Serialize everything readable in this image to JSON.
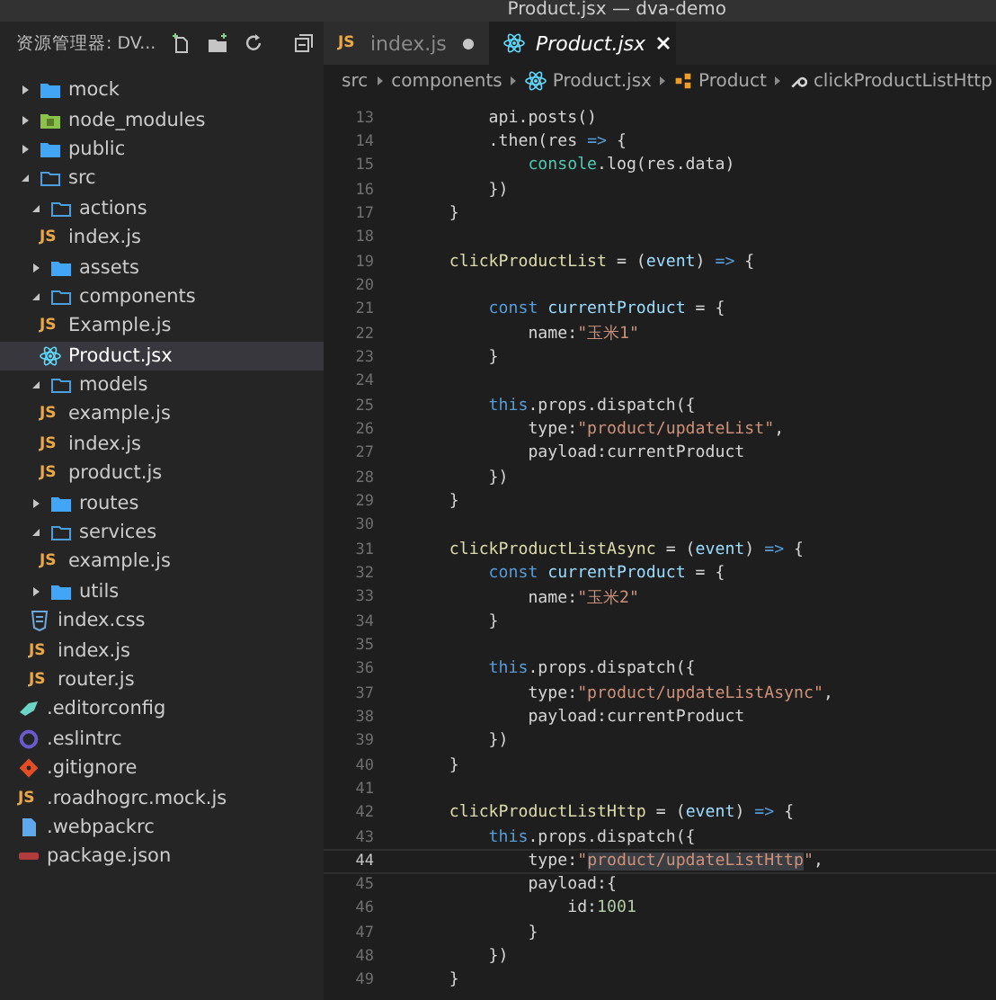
{
  "window": {
    "title": "Product.jsx — dva-demo"
  },
  "explorer": {
    "title": "资源管理器: DV...",
    "tree": [
      {
        "name": "mock",
        "kind": "folder",
        "expanded": false,
        "selected": false
      },
      {
        "name": "node_modules",
        "kind": "modules-folder",
        "expanded": false,
        "selected": false
      },
      {
        "name": "public",
        "kind": "folder",
        "expanded": false,
        "selected": false
      },
      {
        "name": "src",
        "kind": "folder",
        "expanded": true,
        "selected": false,
        "children": [
          {
            "name": "actions",
            "kind": "folder",
            "expanded": true,
            "selected": false,
            "children": [
              {
                "name": "index.js",
                "kind": "js",
                "badge": "JS",
                "selected": false
              }
            ]
          },
          {
            "name": "assets",
            "kind": "folder",
            "expanded": false,
            "selected": false
          },
          {
            "name": "components",
            "kind": "folder",
            "expanded": true,
            "selected": false,
            "children": [
              {
                "name": "Example.js",
                "kind": "js",
                "badge": "JS",
                "selected": false
              },
              {
                "name": "Product.jsx",
                "kind": "react",
                "selected": true
              }
            ]
          },
          {
            "name": "models",
            "kind": "folder",
            "expanded": true,
            "selected": false,
            "children": [
              {
                "name": "example.js",
                "kind": "js",
                "badge": "JS",
                "selected": false
              },
              {
                "name": "index.js",
                "kind": "js",
                "badge": "JS",
                "selected": false
              },
              {
                "name": "product.js",
                "kind": "js",
                "badge": "JS",
                "selected": false
              }
            ]
          },
          {
            "name": "routes",
            "kind": "folder",
            "expanded": false,
            "selected": false
          },
          {
            "name": "services",
            "kind": "folder",
            "expanded": true,
            "selected": false,
            "children": [
              {
                "name": "example.js",
                "kind": "js",
                "badge": "JS",
                "selected": false
              }
            ]
          },
          {
            "name": "utils",
            "kind": "folder",
            "expanded": false,
            "selected": false
          },
          {
            "name": "index.css",
            "kind": "css",
            "selected": false
          },
          {
            "name": "index.js",
            "kind": "js",
            "badge": "JS",
            "selected": false
          },
          {
            "name": "router.js",
            "kind": "js",
            "badge": "JS",
            "selected": false
          }
        ]
      },
      {
        "name": ".editorconfig",
        "kind": "config",
        "selected": false
      },
      {
        "name": ".eslintrc",
        "kind": "eslint",
        "selected": false
      },
      {
        "name": ".gitignore",
        "kind": "git",
        "selected": false
      },
      {
        "name": ".roadhogrc.mock.js",
        "kind": "js",
        "badge": "JS",
        "selected": false
      },
      {
        "name": ".webpackrc",
        "kind": "file",
        "selected": false
      },
      {
        "name": "package.json",
        "kind": "json",
        "selected": false
      }
    ]
  },
  "tabs": [
    {
      "label": "index.js",
      "kind": "js",
      "badge": "JS",
      "selected": false,
      "modified": true
    },
    {
      "label": "Product.jsx",
      "kind": "react",
      "selected": true,
      "modified": false
    }
  ],
  "breadcrumb": [
    {
      "label": "src",
      "kind": "folder"
    },
    {
      "label": "components",
      "kind": "folder"
    },
    {
      "label": "Product.jsx",
      "kind": "react"
    },
    {
      "label": "Product",
      "kind": "class"
    },
    {
      "label": "clickProductListHttp",
      "kind": "method"
    }
  ],
  "code": [
    {
      "number": "13",
      "current": false,
      "tokens": [
        {
          "kind": "plain",
          "text": "        api.posts()"
        }
      ]
    },
    {
      "number": "14",
      "current": false,
      "tokens": [
        {
          "kind": "plain",
          "text": "        .then(res "
        },
        {
          "kind": "keyword",
          "text": "=>"
        },
        {
          "kind": "plain",
          "text": " {"
        }
      ]
    },
    {
      "number": "15",
      "current": false,
      "tokens": [
        {
          "kind": "type",
          "text": "            console"
        },
        {
          "kind": "plain",
          "text": ".log(res.data)"
        }
      ]
    },
    {
      "number": "16",
      "current": false,
      "tokens": [
        {
          "kind": "plain",
          "text": "        })"
        }
      ]
    },
    {
      "number": "17",
      "current": false,
      "tokens": [
        {
          "kind": "plain",
          "text": "    }"
        }
      ]
    },
    {
      "number": "18",
      "current": false
    },
    {
      "number": "19",
      "current": false,
      "tokens": [
        {
          "kind": "func",
          "text": "    clickProductList"
        },
        {
          "kind": "plain",
          "text": " = ("
        },
        {
          "kind": "variable",
          "text": "event"
        },
        {
          "kind": "plain",
          "text": ") "
        },
        {
          "kind": "keyword",
          "text": "=>"
        },
        {
          "kind": "plain",
          "text": " {"
        }
      ]
    },
    {
      "number": "20",
      "current": false
    },
    {
      "number": "21",
      "current": false,
      "tokens": [
        {
          "kind": "keyword",
          "text": "        const"
        },
        {
          "kind": "variable",
          "text": " currentProduct"
        },
        {
          "kind": "plain",
          "text": " = {"
        }
      ]
    },
    {
      "number": "22",
      "current": false,
      "tokens": [
        {
          "kind": "plain",
          "text": "            name:"
        },
        {
          "kind": "string",
          "text": "\"玉米1\""
        }
      ]
    },
    {
      "number": "23",
      "current": false,
      "tokens": [
        {
          "kind": "plain",
          "text": "        }"
        }
      ]
    },
    {
      "number": "24",
      "current": false
    },
    {
      "number": "25",
      "current": false,
      "tokens": [
        {
          "kind": "keyword",
          "text": "        this"
        },
        {
          "kind": "plain",
          "text": ".props.dispatch({"
        }
      ]
    },
    {
      "number": "26",
      "current": false,
      "tokens": [
        {
          "kind": "plain",
          "text": "            type:"
        },
        {
          "kind": "string",
          "text": "\"product/updateList\""
        },
        {
          "kind": "plain",
          "text": ","
        }
      ]
    },
    {
      "number": "27",
      "current": false,
      "tokens": [
        {
          "kind": "plain",
          "text": "            payload:currentProduct"
        }
      ]
    },
    {
      "number": "28",
      "current": false,
      "tokens": [
        {
          "kind": "plain",
          "text": "        })"
        }
      ]
    },
    {
      "number": "29",
      "current": false,
      "tokens": [
        {
          "kind": "plain",
          "text": "    }"
        }
      ]
    },
    {
      "number": "30",
      "current": false
    },
    {
      "number": "31",
      "current": false,
      "tokens": [
        {
          "kind": "func",
          "text": "    clickProductListAsync"
        },
        {
          "kind": "plain",
          "text": " = ("
        },
        {
          "kind": "variable",
          "text": "event"
        },
        {
          "kind": "plain",
          "text": ") "
        },
        {
          "kind": "keyword",
          "text": "=>"
        },
        {
          "kind": "plain",
          "text": " {"
        }
      ]
    },
    {
      "number": "32",
      "current": false,
      "tokens": [
        {
          "kind": "keyword",
          "text": "        const"
        },
        {
          "kind": "variable",
          "text": " currentProduct"
        },
        {
          "kind": "plain",
          "text": " = {"
        }
      ]
    },
    {
      "number": "33",
      "current": false,
      "tokens": [
        {
          "kind": "plain",
          "text": "            name:"
        },
        {
          "kind": "string",
          "text": "\"玉米2\""
        }
      ]
    },
    {
      "number": "34",
      "current": false,
      "tokens": [
        {
          "kind": "plain",
          "text": "        }"
        }
      ]
    },
    {
      "number": "35",
      "current": false
    },
    {
      "number": "36",
      "current": false,
      "tokens": [
        {
          "kind": "keyword",
          "text": "        this"
        },
        {
          "kind": "plain",
          "text": ".props.dispatch({"
        }
      ]
    },
    {
      "number": "37",
      "current": false,
      "tokens": [
        {
          "kind": "plain",
          "text": "            type:"
        },
        {
          "kind": "string",
          "text": "\"product/updateListAsync\""
        },
        {
          "kind": "plain",
          "text": ","
        }
      ]
    },
    {
      "number": "38",
      "current": false,
      "tokens": [
        {
          "kind": "plain",
          "text": "            payload:currentProduct"
        }
      ]
    },
    {
      "number": "39",
      "current": false,
      "tokens": [
        {
          "kind": "plain",
          "text": "        })"
        }
      ]
    },
    {
      "number": "40",
      "current": false,
      "tokens": [
        {
          "kind": "plain",
          "text": "    }"
        }
      ]
    },
    {
      "number": "41",
      "current": false
    },
    {
      "number": "42",
      "current": false,
      "tokens": [
        {
          "kind": "func",
          "text": "    clickProductListHttp"
        },
        {
          "kind": "plain",
          "text": " = ("
        },
        {
          "kind": "variable",
          "text": "event"
        },
        {
          "kind": "plain",
          "text": ") "
        },
        {
          "kind": "keyword",
          "text": "=>"
        },
        {
          "kind": "plain",
          "text": " {"
        }
      ]
    },
    {
      "number": "43",
      "current": false,
      "tokens": [
        {
          "kind": "keyword",
          "text": "        this"
        },
        {
          "kind": "plain",
          "text": ".props.dispatch({"
        }
      ]
    },
    {
      "number": "44",
      "current": true,
      "tokens": [
        {
          "kind": "plain",
          "text": "            type:"
        },
        {
          "kind": "string",
          "text": "\""
        },
        {
          "kind": "match",
          "text": "product/updateListHttp"
        },
        {
          "kind": "string",
          "text": "\""
        },
        {
          "kind": "plain",
          "text": ","
        }
      ]
    },
    {
      "number": "45",
      "current": false,
      "tokens": [
        {
          "kind": "plain",
          "text": "            payload:{"
        }
      ]
    },
    {
      "number": "46",
      "current": false,
      "tokens": [
        {
          "kind": "plain",
          "text": "                id:"
        },
        {
          "kind": "number",
          "text": "1001"
        }
      ]
    },
    {
      "number": "47",
      "current": false,
      "tokens": [
        {
          "kind": "plain",
          "text": "            }"
        }
      ]
    },
    {
      "number": "48",
      "current": false,
      "tokens": [
        {
          "kind": "plain",
          "text": "        })"
        }
      ]
    },
    {
      "number": "49",
      "current": false,
      "tokens": [
        {
          "kind": "plain",
          "text": "    }"
        }
      ]
    }
  ]
}
